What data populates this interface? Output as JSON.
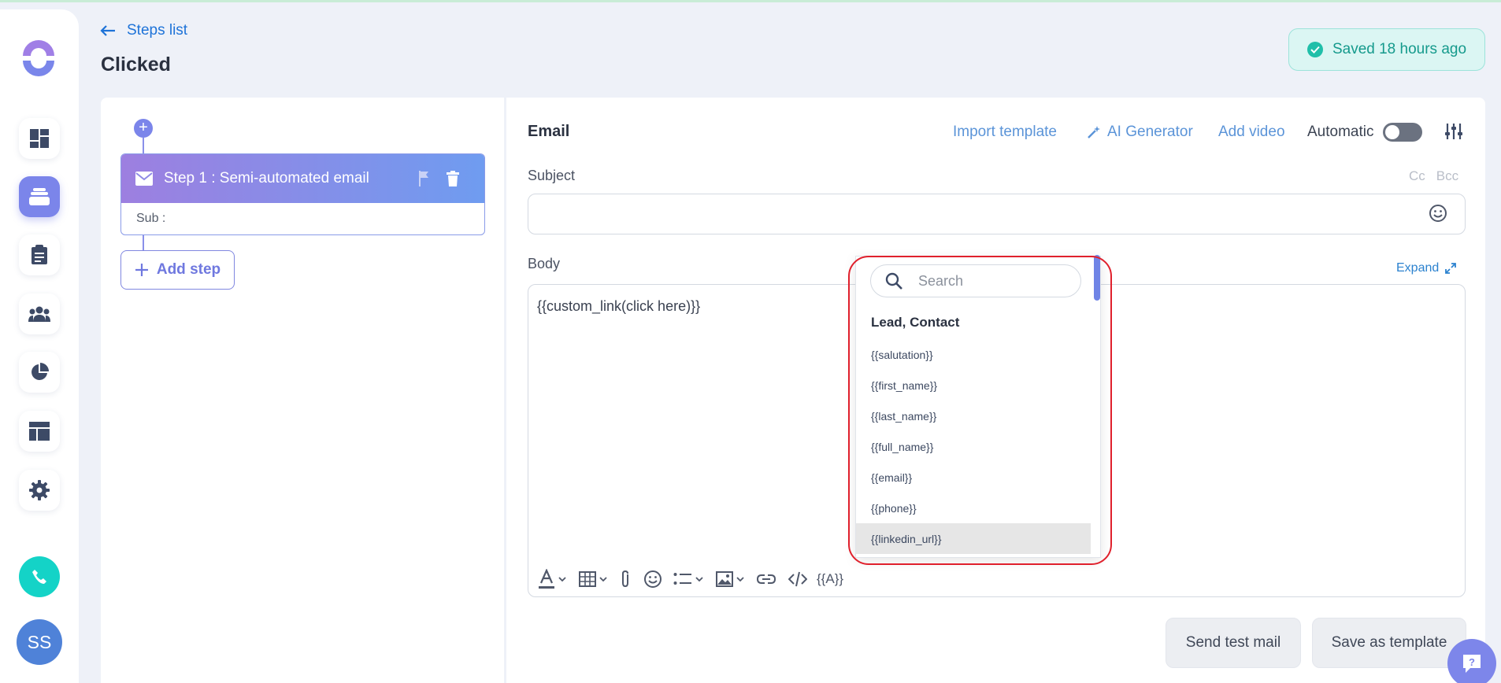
{
  "header": {
    "back_label": "Steps list",
    "title": "Clicked",
    "saved_status": "Saved 18 hours ago"
  },
  "sidebar": {
    "avatar_initials": "SS",
    "items": [
      {
        "icon": "dashboard-icon"
      },
      {
        "icon": "stack-icon",
        "active": true
      },
      {
        "icon": "clipboard-icon"
      },
      {
        "icon": "users-icon"
      },
      {
        "icon": "pie-chart-icon"
      },
      {
        "icon": "layout-icon"
      },
      {
        "icon": "gear-icon"
      }
    ]
  },
  "steps": {
    "step_title": "Step 1 : Semi-automated email",
    "sub_label": "Sub :",
    "add_step_label": "Add step"
  },
  "editor": {
    "type_label": "Email",
    "import_template": "Import template",
    "ai_generator": "AI Generator",
    "add_video": "Add video",
    "automatic_label": "Automatic",
    "automatic_on": false,
    "subject_label": "Subject",
    "cc": "Cc",
    "bcc": "Bcc",
    "subject_value": "",
    "body_label": "Body",
    "expand_label": "Expand",
    "body_text": "{{custom_link(click here)}}",
    "variable_button": "{{A}}",
    "send_test": "Send test mail",
    "save_template": "Save as template"
  },
  "variables_dropdown": {
    "search_placeholder": "Search",
    "group": "Lead, Contact",
    "items": [
      "{{salutation}}",
      "{{first_name}}",
      "{{last_name}}",
      "{{full_name}}",
      "{{email}}",
      "{{phone}}",
      "{{linkedin_url}}"
    ],
    "highlighted_index": 6
  },
  "colors": {
    "accent": "#7b85ea",
    "link": "#5b94d8",
    "success": "#20bfa9",
    "annotation": "#e0202c"
  }
}
